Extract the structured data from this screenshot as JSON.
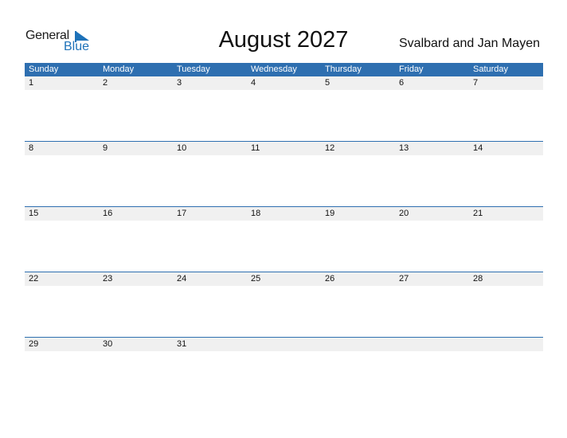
{
  "logo": {
    "general": "General",
    "blue": "Blue",
    "brand_color": "#1e72b9"
  },
  "header": {
    "title": "August 2027",
    "region": "Svalbard and Jan Mayen"
  },
  "calendar": {
    "header_color": "#2e6fb0",
    "weekdays": [
      "Sunday",
      "Monday",
      "Tuesday",
      "Wednesday",
      "Thursday",
      "Friday",
      "Saturday"
    ],
    "weeks": [
      [
        "1",
        "2",
        "3",
        "4",
        "5",
        "6",
        "7"
      ],
      [
        "8",
        "9",
        "10",
        "11",
        "12",
        "13",
        "14"
      ],
      [
        "15",
        "16",
        "17",
        "18",
        "19",
        "20",
        "21"
      ],
      [
        "22",
        "23",
        "24",
        "25",
        "26",
        "27",
        "28"
      ],
      [
        "29",
        "30",
        "31",
        "",
        "",
        "",
        ""
      ]
    ]
  }
}
